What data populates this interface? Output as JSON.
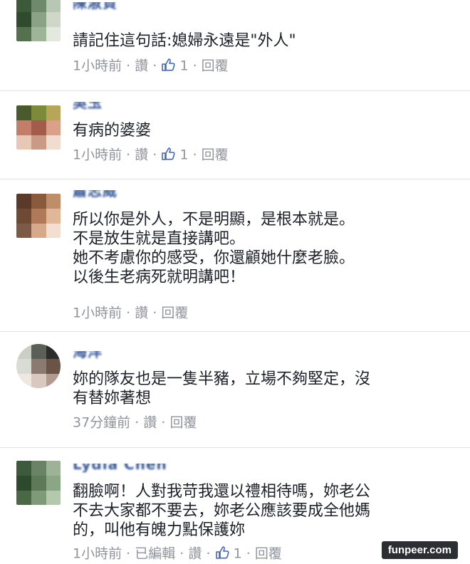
{
  "comments": [
    {
      "author": "陳淑貞",
      "text": "請記住這句話:媳婦永遠是\"外人\"",
      "time": "1小時前",
      "sep": "·",
      "like_label": "讚",
      "like_count": "1",
      "reply_label": "回覆",
      "avatar_colors": [
        "#3c5a3a",
        "#6f8a6a",
        "#b8c7b2",
        "#2f4a2d",
        "#8ba284",
        "#cfd8c8",
        "#54704f",
        "#9fb597",
        "#e4e9e0"
      ]
    },
    {
      "author": "吳玉",
      "text": "有病的婆婆",
      "time": "1小時前",
      "sep": "·",
      "like_label": "讚",
      "like_count": "1",
      "reply_label": "回覆",
      "avatar_colors": [
        "#4a5a2c",
        "#7d8a3a",
        "#b7a55a",
        "#c27e68",
        "#a25c4a",
        "#d9a189",
        "#e7c7b6",
        "#c99a86",
        "#f1ddd0"
      ]
    },
    {
      "author": "蕭志威",
      "text": "所以你是外人，不是明顯，是根本就是。\n不是放生就是直接講吧。\n她不考慮你的感受，你還顧她什麼老臉。\n以後生老病死就明講吧！",
      "time": "1小時前",
      "sep": "·",
      "like_label": "讚",
      "reply_label": "回覆",
      "avatar_colors": [
        "#5b3a2a",
        "#8a5a3d",
        "#c08d6b",
        "#6e4a34",
        "#b07a5a",
        "#e1b79a",
        "#7d5a45",
        "#d4a98c",
        "#f2dfd1"
      ]
    },
    {
      "author": "海洋",
      "text": "妳的隊友也是一隻半豬，立場不夠堅定，沒\n有替妳著想",
      "time": "37分鐘前",
      "sep": "·",
      "like_label": "讚",
      "reply_label": "回覆",
      "avatar_colors": [
        "#c9cfc4",
        "#5a5f58",
        "#2b2d2a",
        "#d8dcd4",
        "#8a7a70",
        "#6a5448",
        "#efe7e2",
        "#d9c8bf",
        "#b29a8e"
      ]
    },
    {
      "author": "Lydia Chen",
      "text": "翻臉啊！人對我苛我還以禮相待嗎，妳老公\n不去大家都不要去，妳老公應該要成全他媽\n的，叫他有魄力點保護妳",
      "time": "1小時前",
      "sep": "·",
      "edited_label": "已編輯",
      "like_label": "讚",
      "like_count": "1",
      "reply_label": "回覆",
      "avatar_colors": [
        "#3e5a3c",
        "#6a8266",
        "#9db297",
        "#2e4a2c",
        "#5d7a58",
        "#8aa684",
        "#4a6846",
        "#7e9a78",
        "#b4c8ae"
      ]
    }
  ],
  "watermark": "funpeer.com",
  "colors": {
    "link": "#365899",
    "meta": "#90949c",
    "like_icon": "#4267b2"
  }
}
